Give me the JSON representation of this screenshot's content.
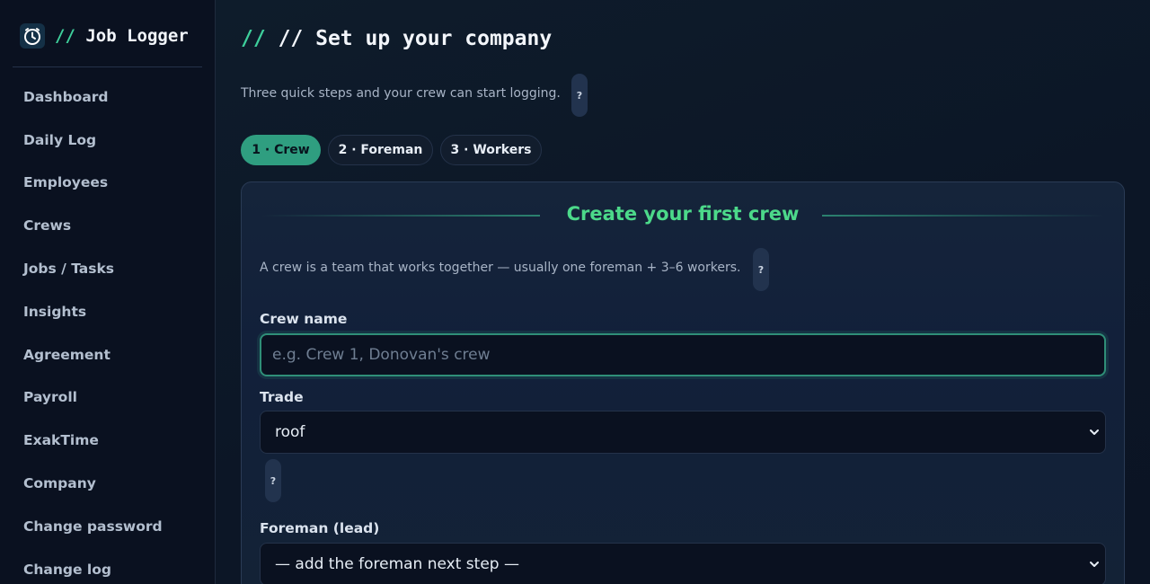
{
  "app": {
    "brand_slashes": "//",
    "brand_name": "Job Logger",
    "logo_icon": "stopwatch-icon",
    "accent_color": "#3ecf9b"
  },
  "sidebar": {
    "items": [
      {
        "label": "Dashboard"
      },
      {
        "label": "Daily Log"
      },
      {
        "label": "Employees"
      },
      {
        "label": "Crews"
      },
      {
        "label": "Jobs / Tasks"
      },
      {
        "label": "Insights"
      },
      {
        "label": "Agreement"
      },
      {
        "label": "Payroll"
      },
      {
        "label": "ExakTime"
      },
      {
        "label": "Company"
      },
      {
        "label": "Change password"
      },
      {
        "label": "Change log"
      }
    ]
  },
  "header": {
    "title_slashes": "//",
    "title": "// Set up your company",
    "subtitle": "Three quick steps and your crew can start logging.",
    "help_label": "?"
  },
  "steps": [
    {
      "label": "1 · Crew",
      "active": true
    },
    {
      "label": "2 · Foreman",
      "active": false
    },
    {
      "label": "3 · Workers",
      "active": false
    }
  ],
  "card": {
    "title": "Create your first crew",
    "description": "A crew is a team that works together — usually one foreman + 3–6 workers.",
    "help_label": "?",
    "crew_name": {
      "label": "Crew name",
      "value": "",
      "placeholder": "e.g. Crew 1, Donovan's crew"
    },
    "trade": {
      "label": "Trade",
      "selected": "roof",
      "help_label": "?"
    },
    "foreman": {
      "label": "Foreman (lead)",
      "selected": "— add the foreman next step —"
    }
  }
}
